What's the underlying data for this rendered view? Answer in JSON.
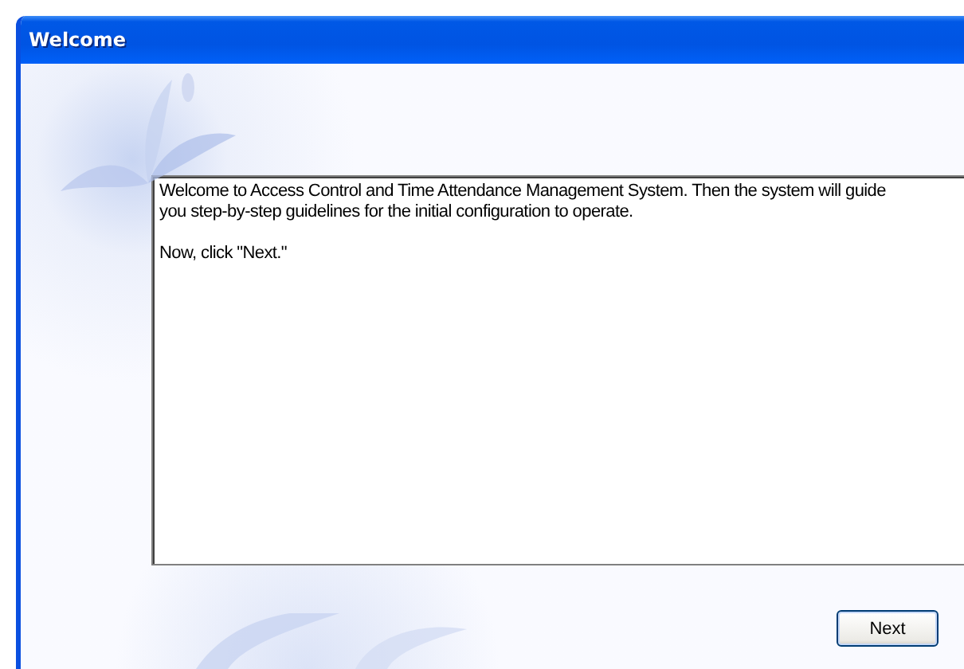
{
  "window": {
    "title": "Welcome"
  },
  "message": {
    "paragraphs": [
      "Welcome to Access Control and Time Attendance Management System. Then the system will guide you step-by-step guidelines for the initial configuration to operate.",
      "Now, click \"Next.\""
    ]
  },
  "buttons": [
    {
      "label": "Next"
    }
  ]
}
